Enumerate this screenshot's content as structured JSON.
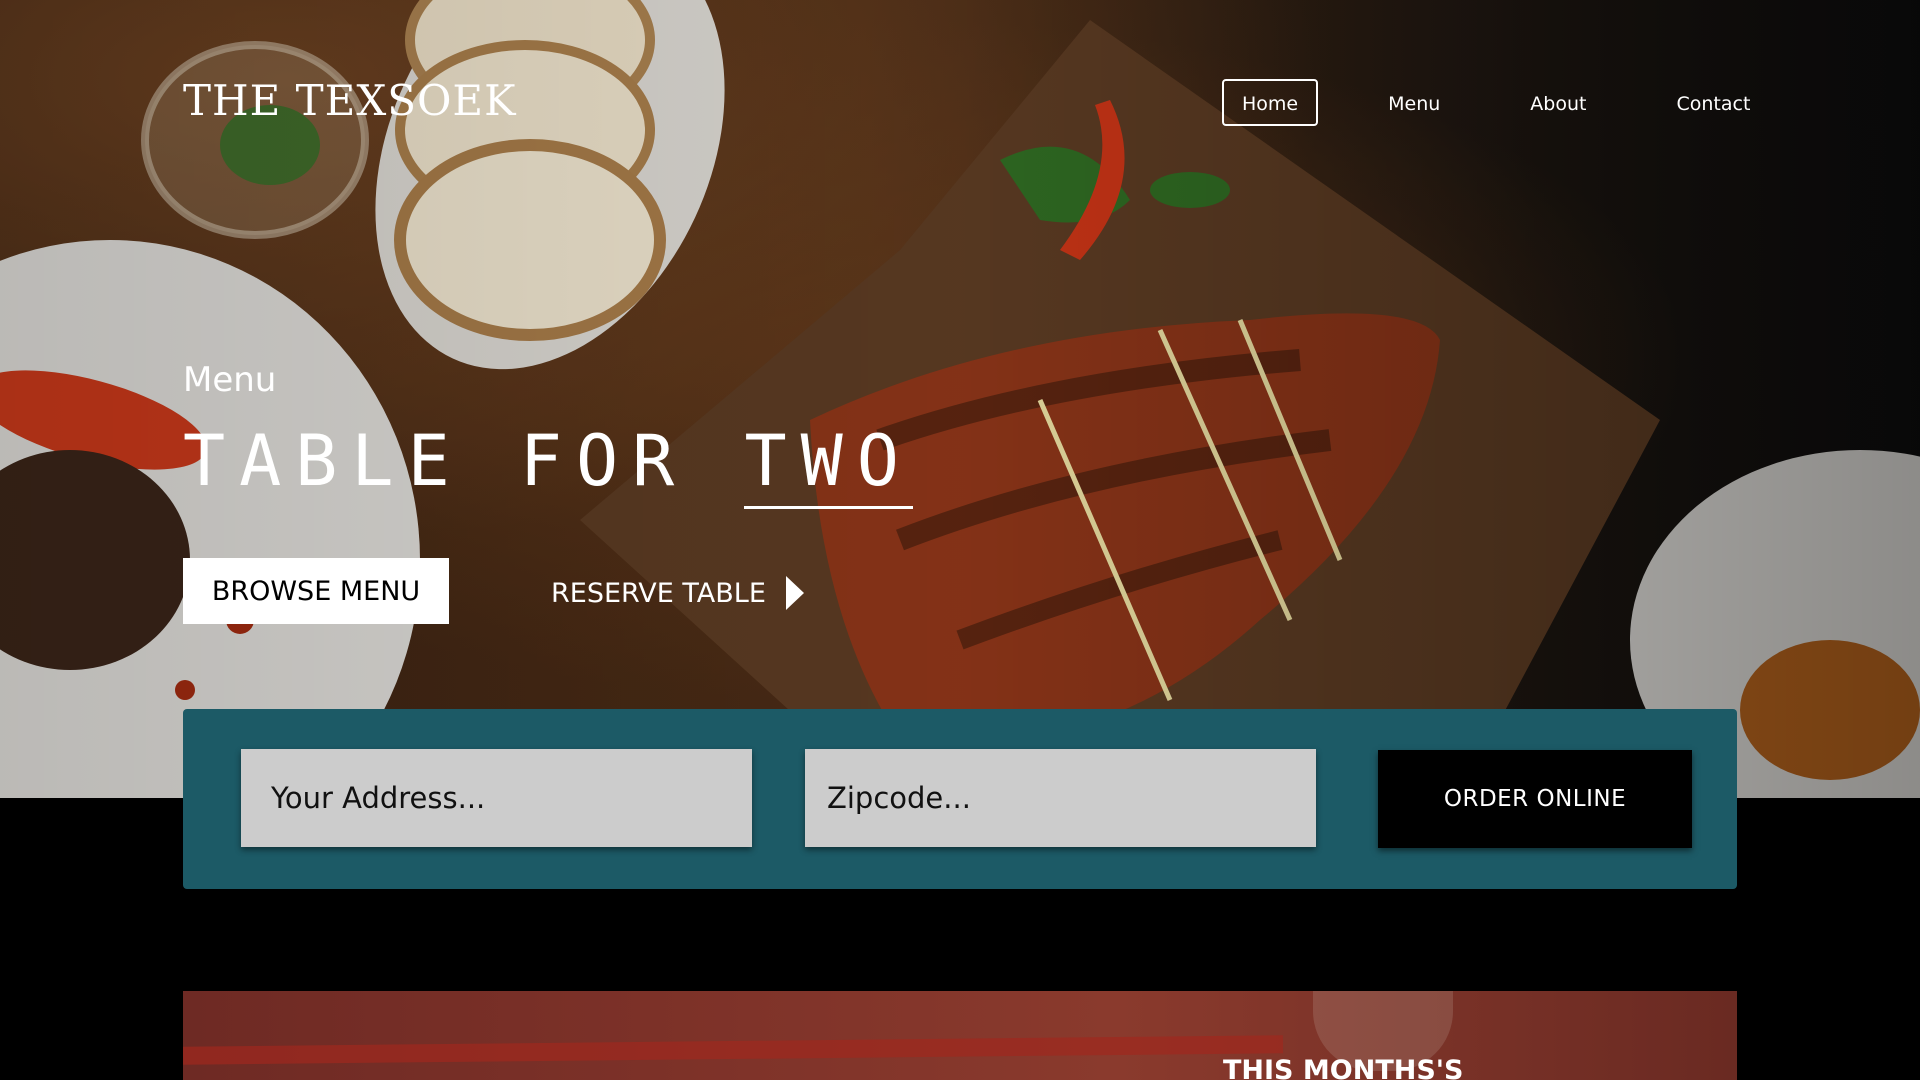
{
  "brand": {
    "name": "THE TEXSOEK"
  },
  "nav": {
    "items": [
      {
        "label": "Home",
        "active": true
      },
      {
        "label": "Menu",
        "active": false
      },
      {
        "label": "About",
        "active": false
      },
      {
        "label": "Contact",
        "active": false
      }
    ]
  },
  "hero": {
    "eyebrow": "Menu",
    "headline_part1": "TABLE FOR",
    "headline_part2": "TWO",
    "browse_label": "BROWSE MENU",
    "reserve_label": "RESERVE TABLE"
  },
  "order": {
    "address_placeholder": "Your Address...",
    "zipcode_placeholder": "Zipcode...",
    "button_label": "ORDER ONLINE"
  },
  "promo": {
    "title": "THIS MONTHS'S"
  },
  "colors": {
    "order_bar": "#1c5a66",
    "field_bg": "#cccccc",
    "page_bg": "#000000"
  }
}
